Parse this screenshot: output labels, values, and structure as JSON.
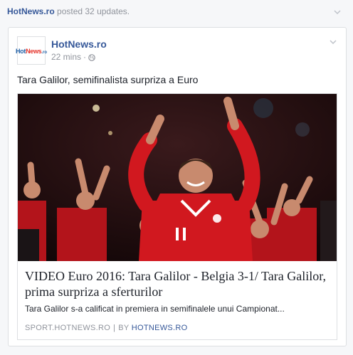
{
  "header": {
    "page_name": "HotNews.ro",
    "action_text": " posted 32 updates."
  },
  "post": {
    "avatar_text": {
      "hot": "Hot",
      "news": "News",
      "ro": ".ro"
    },
    "page_name": "HotNews.ro",
    "time": "22 mins",
    "separator": "·",
    "text": "Tara Galilor, semifinalista surpriza a Euro"
  },
  "link": {
    "title": "VIDEO Euro 2016: Tara Galilor - Belgia 3-1/ Tara Galilor, prima surpriza a sferturilor",
    "description": "Tara Galilor s-a calificat in premiera in semifinalele unui Campionat...",
    "source": "SPORT.HOTNEWS.RO",
    "source_sep": "|",
    "by_prefix": "BY ",
    "by_name": "HOTNEWS.RO"
  },
  "icons": [
    "chevron-down-icon",
    "globe-icon",
    "hotnews-logo"
  ],
  "colors": {
    "link_blue": "#365899",
    "meta_gray": "#90949c",
    "wales_red": "#d1181f"
  }
}
